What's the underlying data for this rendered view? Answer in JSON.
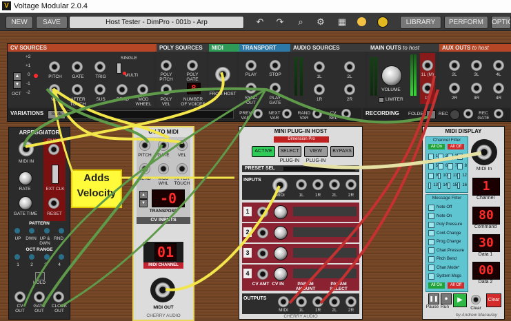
{
  "app": {
    "title": "Voltage Modular 2.0.4"
  },
  "toolbar": {
    "new_label": "NEW",
    "save_label": "SAVE",
    "preset_name": "Host Tester - DimPro - 001b - Arp",
    "library_label": "LIBRARY",
    "perform_label": "PERFORM",
    "options_label": "OPTIONS",
    "icons": [
      "undo-icon",
      "redo-icon",
      "search-icon",
      "gear-icon",
      "checker-icon",
      "light-icon",
      "logo-icon"
    ]
  },
  "cv_sources": {
    "title": "CV SOURCES",
    "oct_label": "OCT",
    "oct_values": [
      "+2",
      "+1",
      "0",
      "-1",
      "-2"
    ],
    "jack_labels_top": [
      "PITCH",
      "GATE",
      "TRIG"
    ],
    "jack_labels_bottom": [
      "VEL",
      "AFTER TOUCH",
      "SUS",
      "BEND",
      "MOD WHEEL"
    ],
    "single_label": "SINGLE",
    "multi_label": "MULTI"
  },
  "poly_sources": {
    "title": "POLY SOURCES",
    "labels": [
      "POLY PITCH",
      "POLY GATE",
      "POLY VEL",
      "NUMBER OF VOICES"
    ],
    "voices_display": "8"
  },
  "midi": {
    "title": "MIDI",
    "from_host_label": "FROM HOST"
  },
  "transport": {
    "title": "TRANSPORT",
    "labels": [
      "PLAY",
      "STOP",
      "SYNC OUT",
      "PLAY GATE"
    ]
  },
  "audio_sources": {
    "title": "AUDIO SOURCES",
    "labels": [
      "1L",
      "2L",
      "1R",
      "2R"
    ]
  },
  "main_outs": {
    "title": "MAIN OUTS",
    "title_suffix": "to host",
    "volume_label": "VOLUME",
    "limiter_label": "LIMITER",
    "labels": [
      "1L (M)",
      "1R"
    ]
  },
  "aux_outs": {
    "title": "AUX OUTS",
    "title_suffix": "to host",
    "labels": [
      "2L",
      "3L",
      "4L",
      "2R",
      "3R",
      "4R"
    ]
  },
  "variations": {
    "title": "VARIATIONS",
    "save_label": "SAVE",
    "prev_label": "PREV VAR",
    "next_label": "NEXT VAR",
    "rand_label": "RAND VAR",
    "cv_label": "CV SEL"
  },
  "recording": {
    "title": "RECORDING",
    "folder_label": "FOLDER",
    "rec_label": "REC",
    "rec_gate_label": "REC GATE"
  },
  "arpeggiator": {
    "title": "ARPEGGIATOR",
    "midi_in_label": "MIDI IN",
    "clk_in_label": "CLK IN",
    "rate_label": "RATE",
    "ext_clk_label": "EXT CLK",
    "gate_time_label": "GATE TIME",
    "reset_label": "RESET",
    "pattern_label": "PATTERN",
    "patterns": [
      "UP",
      "DWN",
      "UP & DWN",
      "RND"
    ],
    "oct_range_label": "OCT RANGE",
    "oct_ranges": [
      "1",
      "2",
      "3",
      "4"
    ],
    "hold_label": "HOLD",
    "outs": [
      "CV OUT",
      "GATE OUT",
      "CLOCK OUT"
    ]
  },
  "cv_to_midi": {
    "title": "CV TO MIDI",
    "jack_labels": [
      "PITCH",
      "GATE",
      "VEL",
      "SEND",
      "MOD WHL",
      "AFTER TOUCH"
    ],
    "transpose_label": "TRANSPOSE",
    "transpose_value": "-0",
    "cv_inputs_label": "CV INPUTS",
    "midi_channel_label": "MIDI CHANNEL",
    "midi_channel_value": "01",
    "midi_out_label": "MIDI OUT",
    "brand": "CHERRY AUDIO"
  },
  "annotation": {
    "text_line1": "Adds",
    "text_line2": "Velocity"
  },
  "mini_plugin_host": {
    "title": "MINI PLUG-IN HOST",
    "plugin_name": "Dimension Pro",
    "buttons": [
      "ACTIVE",
      "SELECT PLUG-IN",
      "VIEW PLUG-IN",
      "BYPASS"
    ],
    "preset_sel_label": "PRESET SEL",
    "inputs_label": "INPUTS",
    "input_jacks": [
      "MIDI",
      "1L",
      "1R",
      "2L",
      "2R"
    ],
    "rows": [
      "1",
      "2",
      "3",
      "4"
    ],
    "cv_labels": [
      "CV AMT",
      "CV IN",
      "PARAM AMOUNT",
      "PARAM SELECT"
    ],
    "outputs_label": "OUTPUTS",
    "output_jacks": [
      "MIDI",
      "1L",
      "1R",
      "2L",
      "2R"
    ],
    "brand": "CHERRY AUDIO"
  },
  "midi_display": {
    "title": "MIDI DISPLAY",
    "channel_filter_label": "Channel Filter",
    "all_on_label": "All On",
    "all_off_label": "All Off",
    "channels": [
      "1",
      "2",
      "3",
      "4",
      "5",
      "6",
      "7",
      "8",
      "9",
      "10",
      "11",
      "12",
      "13",
      "14",
      "15",
      "16"
    ],
    "midi_in_label": "MIDI In",
    "channel_value": "1",
    "channel_label": "Channel",
    "message_filter_label": "Message Filter",
    "messages": [
      "Note Off",
      "Note On",
      "Poly Pressure",
      "Cont.Change",
      "Prog.Change",
      "Chan.Pressure",
      "Pitch Bend",
      "Chan.Mode*",
      "System Msgs"
    ],
    "command_value": "80",
    "command_label": "Command",
    "data1_value": "30",
    "data1_label": "Data 1",
    "data2_value": "00",
    "data2_label": "Data 2",
    "controls": [
      "Pause",
      "Run",
      "Clear"
    ],
    "credit": "by Andrew Macaulay"
  },
  "colors": {
    "accent": "#f0c000",
    "cable_yellow": "#f2e64a",
    "cable_green": "#5e9a4a",
    "cable_red": "#c53030",
    "cable_white": "#e6e1a5"
  }
}
